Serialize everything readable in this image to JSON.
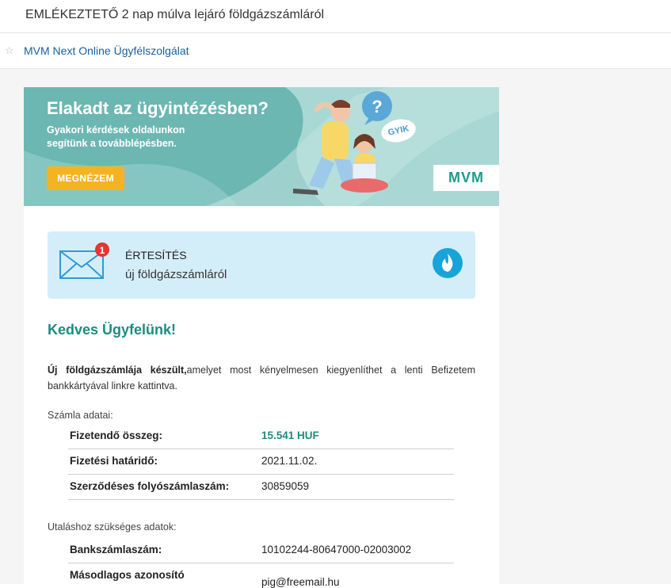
{
  "email": {
    "subject": "EMLÉKEZTETŐ 2 nap múlva lejáró földgázszámláról",
    "sender": "MVM Next Online Ügyfélszolgálat"
  },
  "banner": {
    "title": "Elakadt az ügyintézésben?",
    "subtitle": "Gyakori kérdések oldalunkon segítünk a továbblépésben.",
    "button": "MEGNÉZEM",
    "bubble_text": "GYIK",
    "logo": "MVM"
  },
  "notification": {
    "badge": "1",
    "title": "ÉRTESÍTÉS",
    "subtitle": "új földgázszámláról"
  },
  "body": {
    "greeting": "Kedves Ügyfelünk!",
    "intro_bold": "Új földgázszámlája készült,",
    "intro_rest": "amelyet most kényelmesen kiegyenlíthet a lenti Befizetem bankkártyával linkre kattintva."
  },
  "invoice": {
    "section_label": "Számla adatai:",
    "rows": [
      {
        "label": "Fizetendő összeg:",
        "value": "15.541 HUF"
      },
      {
        "label": "Fizetési határidő:",
        "value": "2021.11.02."
      },
      {
        "label": "Szerződéses folyószámlaszám:",
        "value": "30859059"
      }
    ]
  },
  "transfer": {
    "section_label": "Utaláshoz szükséges adatok:",
    "rows": [
      {
        "label": "Bankszámlaszám:",
        "value": "10102244-80647000-02003002"
      },
      {
        "label": "Másodlagos azonosító",
        "value": "pig@freemail.hu"
      }
    ]
  },
  "colors": {
    "accent_green": "#1e8c7e",
    "banner_teal": "#6cb7b2",
    "button_orange": "#f6b321",
    "notif_bg": "#d4eef9",
    "link_blue": "#1a5fa0"
  }
}
